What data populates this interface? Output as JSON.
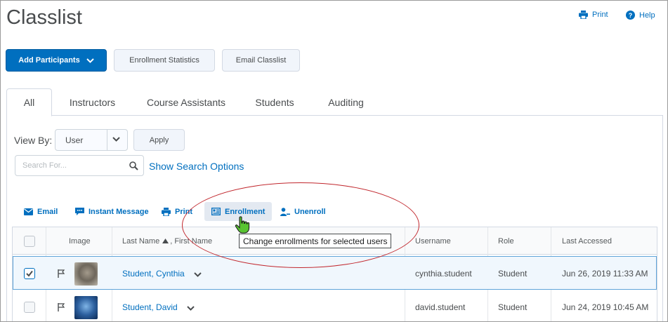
{
  "page": {
    "title": "Classlist"
  },
  "header_links": {
    "print": "Print",
    "help": "Help"
  },
  "toolbar": {
    "add_participants": "Add Participants",
    "enrollment_statistics": "Enrollment Statistics",
    "email_classlist": "Email Classlist"
  },
  "tabs": [
    "All",
    "Instructors",
    "Course Assistants",
    "Students",
    "Auditing"
  ],
  "active_tab": "All",
  "filters": {
    "view_by_label": "View By:",
    "view_by_value": "User",
    "apply": "Apply",
    "search_placeholder": "Search For...",
    "show_search_options": "Show Search Options"
  },
  "actions": {
    "email": "Email",
    "instant_message": "Instant Message",
    "print": "Print",
    "enrollment": "Enrollment",
    "unenroll": "Unenroll"
  },
  "table": {
    "columns": {
      "image": "Image",
      "last_name": "Last Name",
      "first_name": ", First Name",
      "username": "Username",
      "role": "Role",
      "last_accessed": "Last Accessed"
    },
    "rows": [
      {
        "name": "Student, Cynthia",
        "username": "cynthia.student",
        "role": "Student",
        "last_accessed": "Jun 26, 2019 11:33 AM",
        "selected": true
      },
      {
        "name": "Student, David",
        "username": "david.student",
        "role": "Student",
        "last_accessed": "Jun 24, 2019 10:45 AM",
        "selected": false
      }
    ]
  },
  "tooltip": "Change enrollments for selected users",
  "colors": {
    "accent": "#006fbf",
    "annotation": "#c1272d",
    "selected_row": "#f0f7fd"
  }
}
